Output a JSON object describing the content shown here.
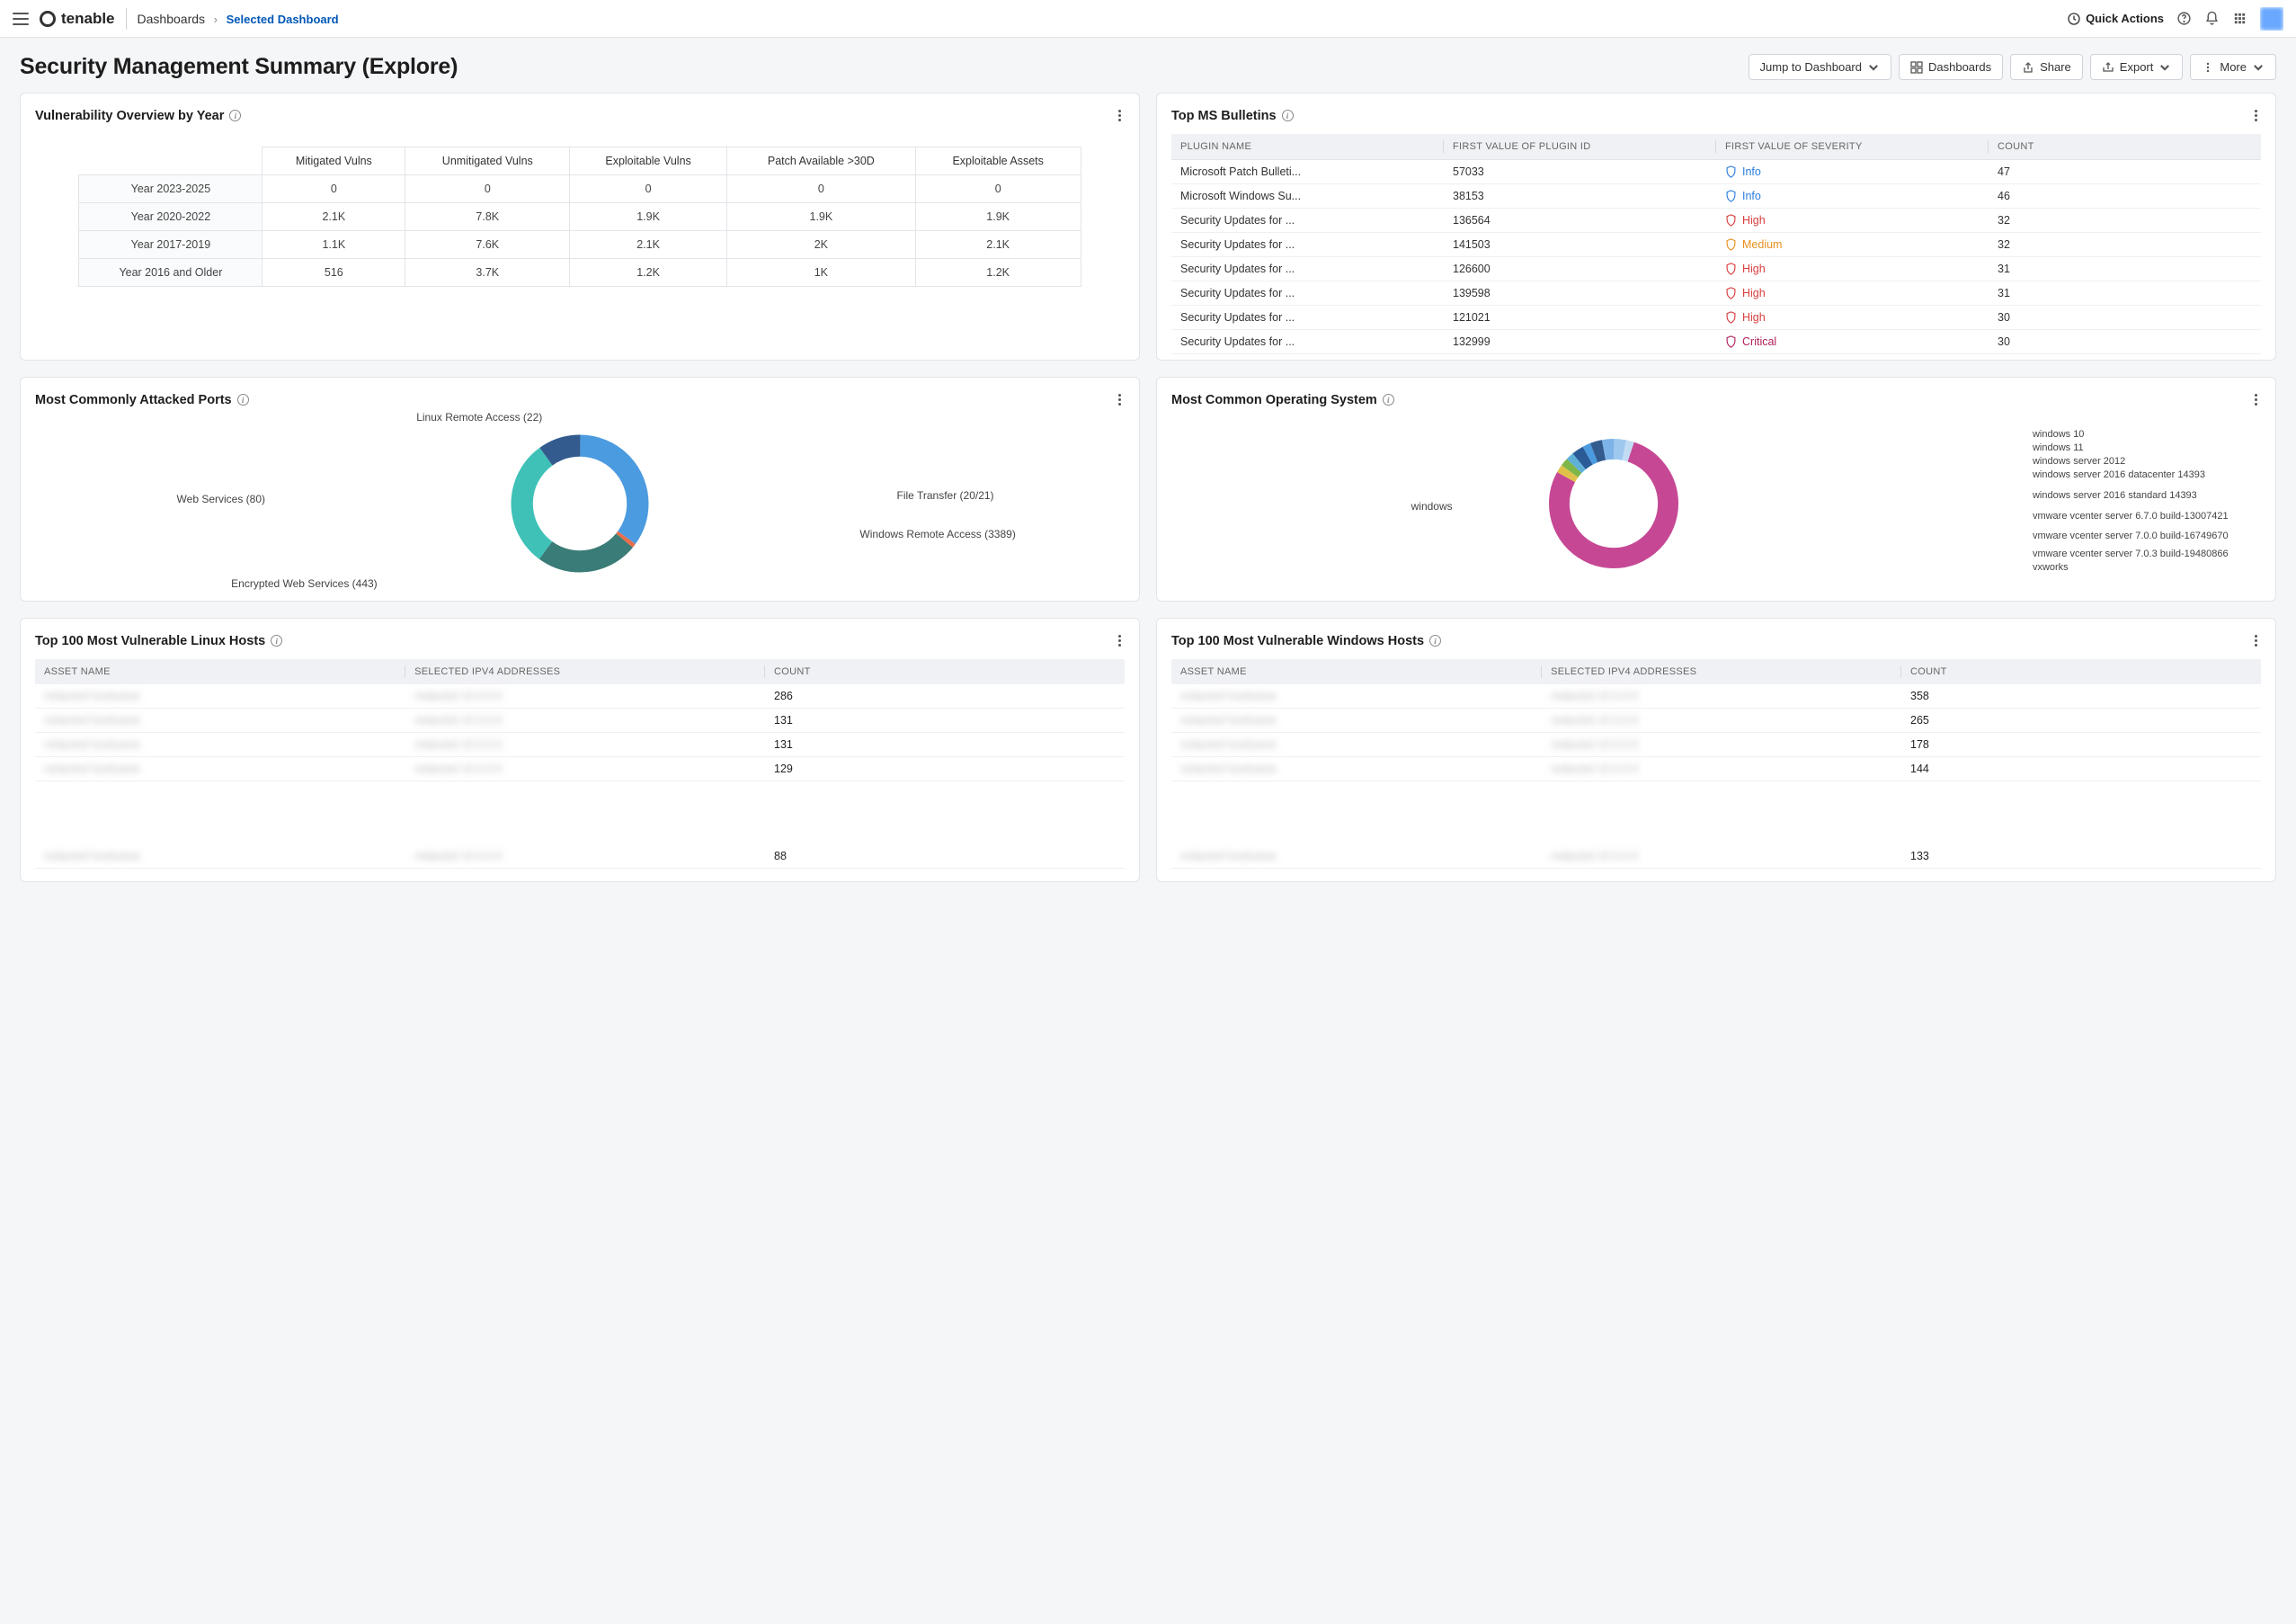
{
  "header": {
    "brand": "tenable",
    "crumb_root": "Dashboards",
    "crumb_sep": "›",
    "crumb_current": "Selected Dashboard",
    "quick_actions": "Quick Actions"
  },
  "page": {
    "title": "Security Management Summary (Explore)",
    "buttons": {
      "jump": "Jump to Dashboard",
      "dashboards": "Dashboards",
      "share": "Share",
      "export": "Export",
      "more": "More"
    }
  },
  "cards": {
    "overview": {
      "title": "Vulnerability Overview by Year",
      "columns": [
        "Mitigated Vulns",
        "Unmitigated Vulns",
        "Exploitable Vulns",
        "Patch Available >30D",
        "Exploitable Assets"
      ],
      "rows": [
        {
          "label": "Year 2023-2025",
          "cells": [
            "0",
            "0",
            "0",
            "0",
            "0"
          ]
        },
        {
          "label": "Year 2020-2022",
          "cells": [
            "2.1K",
            "7.8K",
            "1.9K",
            "1.9K",
            "1.9K"
          ]
        },
        {
          "label": "Year 2017-2019",
          "cells": [
            "1.1K",
            "7.6K",
            "2.1K",
            "2K",
            "2.1K"
          ]
        },
        {
          "label": "Year 2016 and Older",
          "cells": [
            "516",
            "3.7K",
            "1.2K",
            "1K",
            "1.2K"
          ]
        }
      ]
    },
    "bulletins": {
      "title": "Top MS Bulletins",
      "columns": [
        "PLUGIN NAME",
        "FIRST VALUE OF PLUGIN ID",
        "FIRST VALUE OF SEVERITY",
        "COUNT"
      ],
      "rows": [
        {
          "name": "Microsoft Patch Bulleti...",
          "id": "57033",
          "sev": "Info",
          "sev_class": "sev-info",
          "count": "47"
        },
        {
          "name": "Microsoft Windows Su...",
          "id": "38153",
          "sev": "Info",
          "sev_class": "sev-info",
          "count": "46"
        },
        {
          "name": "Security Updates for ...",
          "id": "136564",
          "sev": "High",
          "sev_class": "sev-high",
          "count": "32"
        },
        {
          "name": "Security Updates for ...",
          "id": "141503",
          "sev": "Medium",
          "sev_class": "sev-med",
          "count": "32"
        },
        {
          "name": "Security Updates for ...",
          "id": "126600",
          "sev": "High",
          "sev_class": "sev-high",
          "count": "31"
        },
        {
          "name": "Security Updates for ...",
          "id": "139598",
          "sev": "High",
          "sev_class": "sev-high",
          "count": "31"
        },
        {
          "name": "Security Updates for ...",
          "id": "121021",
          "sev": "High",
          "sev_class": "sev-high",
          "count": "30"
        },
        {
          "name": "Security Updates for ...",
          "id": "132999",
          "sev": "Critical",
          "sev_class": "sev-crit",
          "count": "30"
        }
      ]
    },
    "ports": {
      "title": "Most Commonly Attacked Ports",
      "labels": {
        "linux": "Linux Remote Access (22)",
        "file": "File Transfer (20/21)",
        "win": "Windows Remote Access (3389)",
        "enc": "Encrypted Web Services (443)",
        "web": "Web Services (80)"
      }
    },
    "os": {
      "title": "Most Common Operating System",
      "labels": {
        "windows": "windows",
        "w10": "windows 10",
        "w11": "windows 11",
        "ws2012": "windows server 2012",
        "ws2016d": "windows server 2016 datacenter 14393",
        "ws2016s": "windows server 2016 standard 14393",
        "vc67": "vmware vcenter server 6.7.0 build-13007421",
        "vc70": "vmware vcenter server 7.0.0 build-16749670",
        "vc703": "vmware vcenter server 7.0.3 build-19480866",
        "vx": "vxworks"
      }
    },
    "linux_hosts": {
      "title": "Top 100 Most Vulnerable Linux Hosts",
      "columns": [
        "ASSET NAME",
        "SELECTED IPV4 ADDRESSES",
        "COUNT"
      ],
      "rows": [
        {
          "asset": "redacted",
          "ip": "redacted",
          "count": "286"
        },
        {
          "asset": "redacted",
          "ip": "redacted",
          "count": "131"
        },
        {
          "asset": "redacted",
          "ip": "redacted",
          "count": "131"
        },
        {
          "asset": "redacted",
          "ip": "redacted",
          "count": "129"
        },
        {
          "asset": "redacted",
          "ip": "redacted",
          "count": "88"
        }
      ]
    },
    "win_hosts": {
      "title": "Top 100 Most Vulnerable Windows Hosts",
      "columns": [
        "ASSET NAME",
        "SELECTED IPV4 ADDRESSES",
        "COUNT"
      ],
      "rows": [
        {
          "asset": "redacted",
          "ip": "redacted",
          "count": "358"
        },
        {
          "asset": "redacted",
          "ip": "redacted",
          "count": "265"
        },
        {
          "asset": "redacted",
          "ip": "redacted",
          "count": "178"
        },
        {
          "asset": "redacted",
          "ip": "redacted",
          "count": "144"
        },
        {
          "asset": "redacted",
          "ip": "redacted",
          "count": "133"
        }
      ]
    }
  },
  "chart_data": [
    {
      "type": "pie",
      "title": "Most Commonly Attacked Ports",
      "categories": [
        "Linux Remote Access (22)",
        "File Transfer (20/21)",
        "Windows Remote Access (3389)",
        "Encrypted Web Services (443)",
        "Web Services (80)"
      ],
      "values_pct_of_circle": [
        35,
        1,
        24,
        30,
        10
      ],
      "colors": [
        "#4b9be0",
        "#e96d4a",
        "#3a7c77",
        "#3fc1b8",
        "#335b8e"
      ]
    },
    {
      "type": "pie",
      "title": "Most Common Operating System",
      "categories": [
        "windows",
        "windows 10",
        "windows 11",
        "windows server 2012",
        "windows server 2016 datacenter 14393",
        "windows server 2016 standard 14393",
        "vmware vcenter server 6.7.0 build-13007421",
        "vmware vcenter server 7.0.0 build-16749670",
        "vmware vcenter server 7.0.3 build-19480866",
        "vxworks"
      ],
      "values_pct_of_circle": [
        78,
        2,
        2,
        2,
        3,
        2,
        3,
        3,
        3,
        2
      ],
      "colors": [
        "#c64895",
        "#e0c24a",
        "#7fb648",
        "#5fb1d6",
        "#2a5b96",
        "#4b9be0",
        "#335b8e",
        "#7db4e8",
        "#9fc8ef",
        "#c2dcf4"
      ]
    },
    {
      "type": "table",
      "title": "Vulnerability Overview by Year",
      "columns": [
        "Year Range",
        "Mitigated Vulns",
        "Unmitigated Vulns",
        "Exploitable Vulns",
        "Patch Available >30D",
        "Exploitable Assets"
      ],
      "rows": [
        [
          "Year 2023-2025",
          0,
          0,
          0,
          0,
          0
        ],
        [
          "Year 2020-2022",
          2100,
          7800,
          1900,
          1900,
          1900
        ],
        [
          "Year 2017-2019",
          1100,
          7600,
          2100,
          2000,
          2100
        ],
        [
          "Year 2016 and Older",
          516,
          3700,
          1200,
          1000,
          1200
        ]
      ]
    }
  ]
}
